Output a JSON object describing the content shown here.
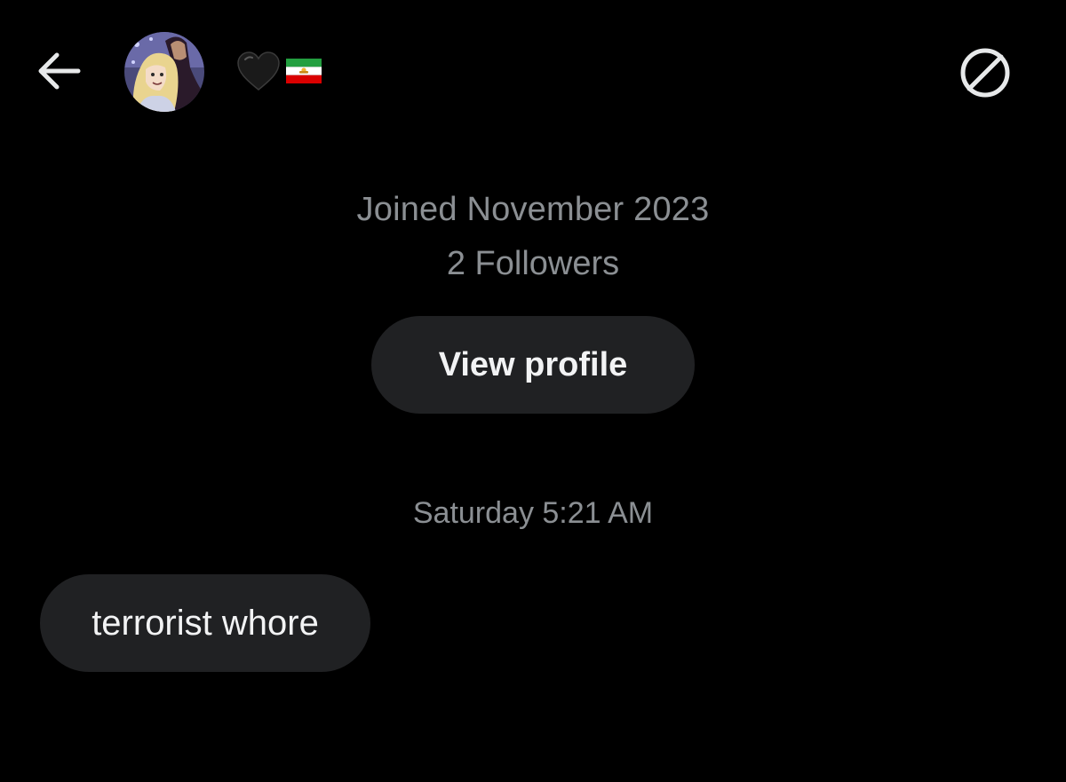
{
  "header": {
    "back_icon": "arrow-left-icon",
    "avatar_icon": "user-avatar-illustration",
    "display_name_emojis": [
      "black-heart-icon",
      "iran-lion-and-sun-flag-icon"
    ],
    "block_icon": "block-circle-slash-icon"
  },
  "profile": {
    "joined": "Joined November 2023",
    "followers": "2 Followers",
    "view_profile_label": "View profile"
  },
  "conversation": {
    "timestamp": "Saturday 5:21 AM",
    "messages": [
      {
        "direction": "received",
        "text": "terrorist whore"
      }
    ]
  },
  "colors": {
    "background": "#000000",
    "muted_text": "#8b8f93",
    "bubble": "#202123",
    "primary_text": "#f2f3f4"
  }
}
